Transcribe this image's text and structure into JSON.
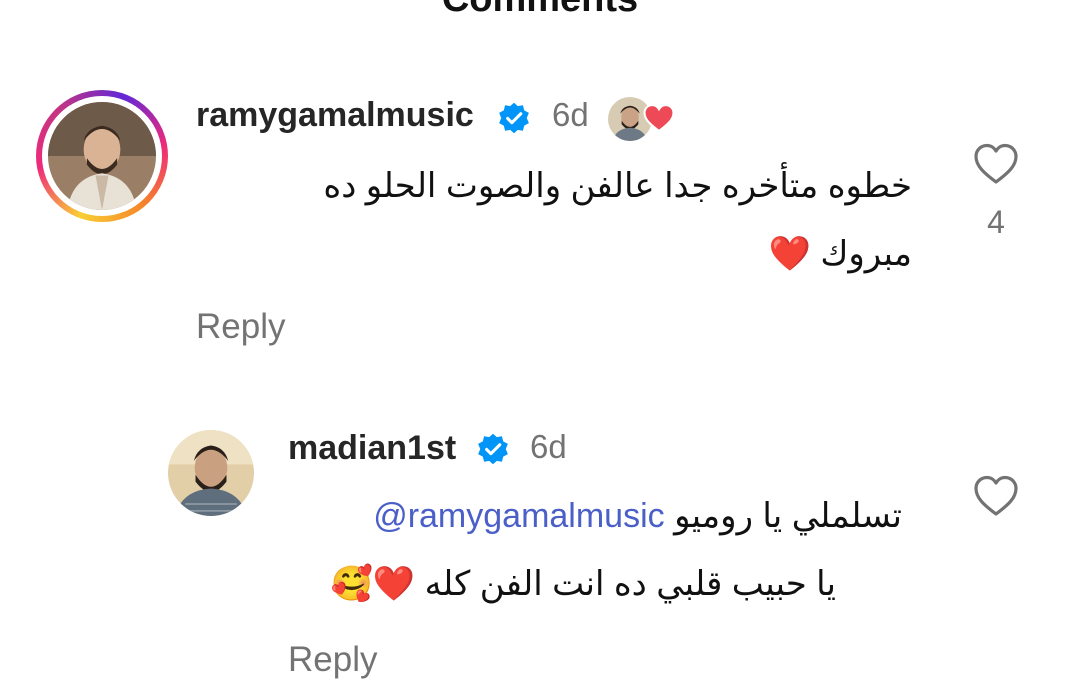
{
  "header": {
    "title": "Comments"
  },
  "comments": [
    {
      "username": "ramygamalmusic",
      "time": "6d",
      "lines": [
        "خطوه متأخره جدا عالفن والصوت الحلو ده",
        "مبروك"
      ],
      "line2_emoji": "❤️",
      "likes": "4",
      "reply_label": "Reply"
    },
    {
      "username": "madian1st",
      "time": "6d",
      "mention": "@ramygamalmusic",
      "line1_text": "تسلملي يا روميو",
      "line2_text": "يا حبيب قلبي ده انت الفن كله",
      "line2_emoji": "❤️🥰",
      "reply_label": "Reply"
    }
  ],
  "colors": {
    "verified": "#0095f6",
    "heart": "#ed4956",
    "mention": "#4a5fc7",
    "muted": "#737373"
  }
}
